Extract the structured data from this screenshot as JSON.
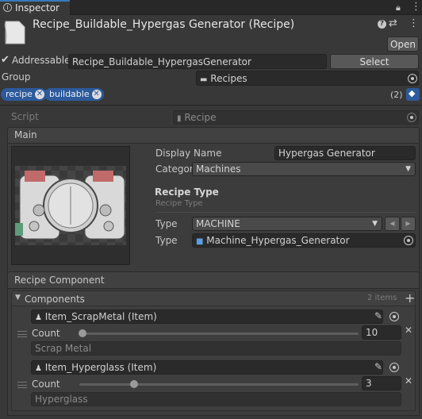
{
  "tab": {
    "title": "Inspector"
  },
  "header": {
    "title": "Recipe_Buildable_Hypergas Generator (Recipe)",
    "open_label": "Open"
  },
  "addressable": {
    "label": "Addressable",
    "checked": true,
    "address": "Recipe_Buildable_HypergasGenerator",
    "select_label": "Select"
  },
  "group": {
    "label": "Group",
    "value": "Recipes"
  },
  "labels": {
    "tags": [
      "recipe",
      "buildable"
    ],
    "count": "(2)"
  },
  "script": {
    "label": "Script",
    "value": "Recipe"
  },
  "main": {
    "title": "Main",
    "display_name_label": "Display Name",
    "display_name_value": "Hypergas Generator",
    "category_label": "Categor",
    "category_value": "Machines",
    "recipe_type_heading": "Recipe Type",
    "recipe_type_sub": "Recipe Type",
    "type_label": "Type",
    "type_enum_value": "MACHINE",
    "type_object_label": "Type",
    "type_object_value": "Machine_Hypergas_Generator"
  },
  "recipe_component": {
    "title": "Recipe Component",
    "components_label": "Components",
    "items_count": "2 items",
    "items": [
      {
        "item": "Item_ScrapMetal (Item)",
        "count_label": "Count",
        "count": "10",
        "slider_fraction": 0.1,
        "name": "Scrap Metal"
      },
      {
        "item": "Item_Hyperglass (Item)",
        "count_label": "Count",
        "count": "3",
        "slider_fraction": 0.32,
        "name": "Hyperglass"
      }
    ]
  },
  "colors": {
    "accent": "#2c5a9c",
    "background": "#383838"
  }
}
